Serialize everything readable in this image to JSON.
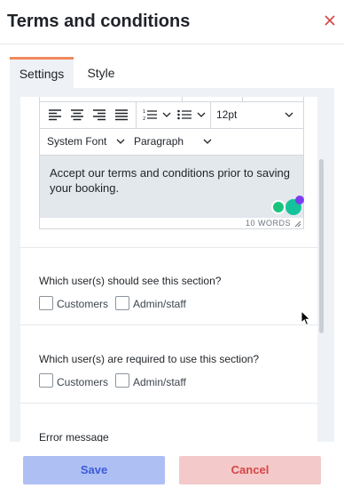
{
  "header": {
    "title": "Terms and conditions",
    "close_icon": "close-icon"
  },
  "tabs": [
    {
      "label": "Settings",
      "active": true
    },
    {
      "label": "Style",
      "active": false
    }
  ],
  "editor": {
    "toolbar": {
      "align_icons": [
        "align-left-icon",
        "align-center-icon",
        "align-right-icon",
        "align-justify-icon"
      ],
      "list_icons": [
        "numbered-list-icon",
        "bulleted-list-icon"
      ],
      "font_size": "12pt",
      "font_family": "System Font",
      "block_format": "Paragraph"
    },
    "content": "Accept our terms and conditions prior to saving your booking.",
    "word_count": "10 WORDS"
  },
  "visibility": {
    "question": "Which user(s) should see this section?",
    "options": [
      "Customers",
      "Admin/staff"
    ]
  },
  "required": {
    "question": "Which user(s) are required to use this section?",
    "options": [
      "Customers",
      "Admin/staff"
    ]
  },
  "error_message": {
    "label": "Error message"
  },
  "footer": {
    "save_label": "Save",
    "cancel_label": "Cancel"
  },
  "colors": {
    "tab_accent": "#f08a5d",
    "save_bg": "#aebff3",
    "save_text": "#3b5bdb",
    "cancel_bg": "#f4c9c9",
    "cancel_text": "#d64545"
  }
}
